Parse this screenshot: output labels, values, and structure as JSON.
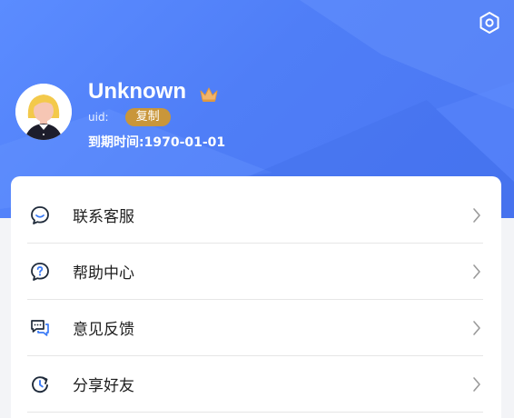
{
  "profile": {
    "name": "Unknown",
    "uid_label": "uid:",
    "copy_label": "复制",
    "expiry": "到期时间:1970-01-01"
  },
  "menu": [
    {
      "label": "联系客服",
      "icon": "chat-bubble-icon"
    },
    {
      "label": "帮助中心",
      "icon": "help-question-icon"
    },
    {
      "label": "意见反馈",
      "icon": "feedback-messages-icon"
    },
    {
      "label": "分享好友",
      "icon": "share-refresh-icon"
    }
  ],
  "colors": {
    "header_blue": "#4f7ef7",
    "copy_badge": "#c9963a",
    "crown": "#f2b56b"
  }
}
